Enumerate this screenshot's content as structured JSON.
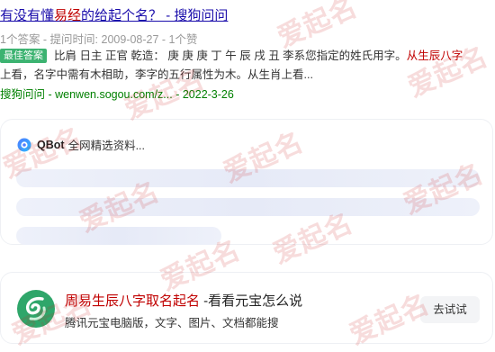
{
  "result": {
    "title_pre": "有没有懂",
    "title_hl": "易经",
    "title_post": "的给起个名？ - 搜狗问问",
    "meta": "1个答案 - 提问时间: 2009-08-27 - 1个赞",
    "badge": "最佳答案",
    "snippet_1": "比肩 日主 正官 乾造： 庚 庚 庚 丁 午 辰 戌 丑 李系您指定的姓氏用字。",
    "snippet_hl": "从生辰八字",
    "snippet_2": "上看，名字中需有木相助，李字的五行属性为木。从生肖上看...",
    "source": "搜狗问问 - wenwen.sogou.com/z... - 2022-3-26"
  },
  "qbot": {
    "name": "QBot",
    "status": "全网精选资料..."
  },
  "ad": {
    "title_brand": "周易生辰八字取名起名",
    "title_rest": " -看看元宝怎么说",
    "subtitle": "腾讯元宝电脑版，文字、图片、文档都能搜",
    "button_label": "去试试"
  },
  "watermark": {
    "text": "爱起名"
  },
  "colors": {
    "link": "#1a0dab",
    "highlight": "#c00000",
    "source": "#008000",
    "badge": "#3cb371",
    "watermark": "rgba(205,40,40,0.16)"
  }
}
